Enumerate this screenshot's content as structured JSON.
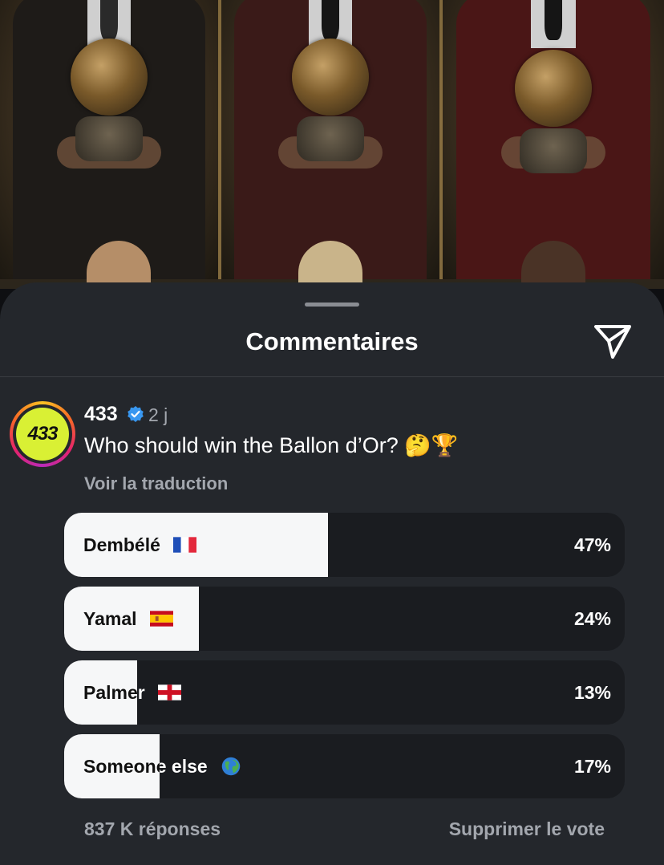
{
  "sheet": {
    "title": "Commentaires"
  },
  "post": {
    "author": "433",
    "avatar_text": "433",
    "time": "2 j",
    "question": "Who should win the Ballon d’Or? 🤔🏆",
    "see_translation": "Voir la traduction"
  },
  "poll": {
    "options": [
      {
        "label": "Dembélé",
        "flag": "france-flag-icon",
        "percent_label": "47%",
        "percent": 47
      },
      {
        "label": "Yamal",
        "flag": "spain-flag-icon",
        "percent_label": "24%",
        "percent": 24
      },
      {
        "label": "Palmer",
        "flag": "england-flag-icon",
        "percent_label": "13%",
        "percent": 13
      },
      {
        "label": "Someone else",
        "flag": "globe-icon",
        "percent_label": "17%",
        "percent": 17
      }
    ],
    "responses": "837 K réponses",
    "remove_vote": "Supprimer le vote"
  },
  "colors": {
    "sheet_bg": "#24272c",
    "bar_fill": "#f6f7f8",
    "bar_track": "#1a1c20",
    "verified_blue": "#3897f0",
    "avatar_yellow": "#d9f034"
  }
}
